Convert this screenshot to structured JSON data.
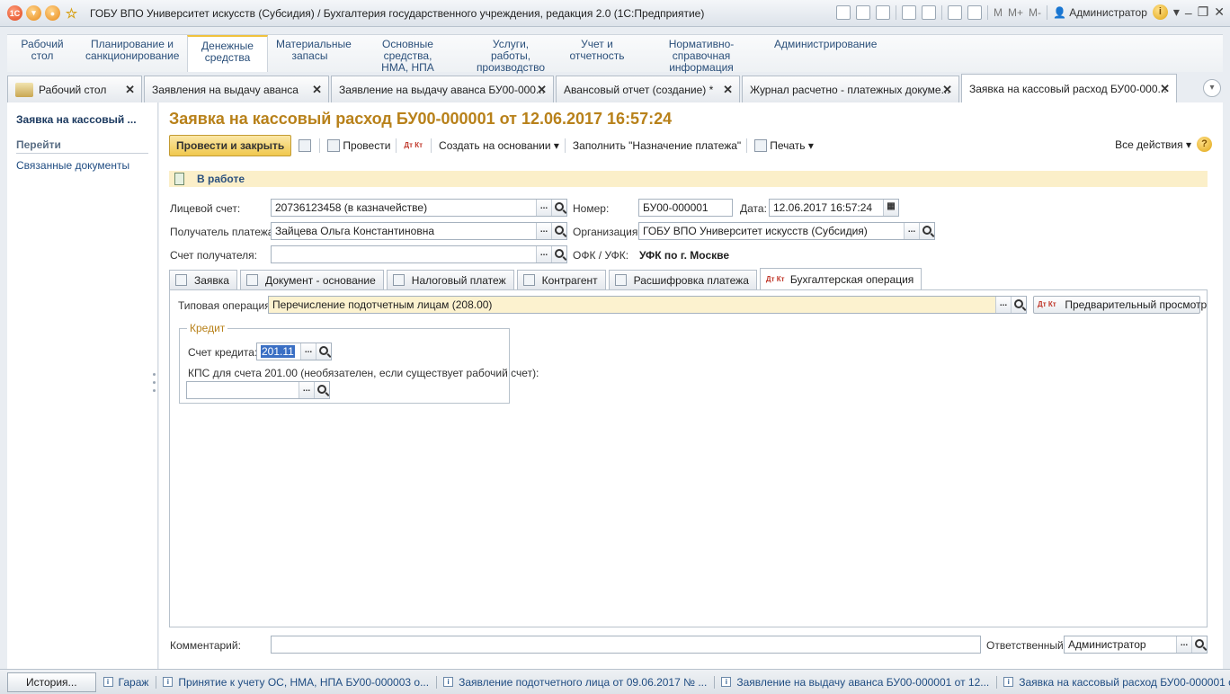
{
  "window": {
    "title": "ГОБУ ВПО Университет искусств (Субсидия) / Бухгалтерия государственного учреждения, редакция 2.0  (1С:Предприятие)",
    "user": "Администратор",
    "memory_buttons": [
      "M",
      "M+",
      "M-"
    ]
  },
  "sections": [
    {
      "label": "Рабочий\nстол"
    },
    {
      "label": "Планирование и\nсанкционирование"
    },
    {
      "label": "Денежные\nсредства"
    },
    {
      "label": "Материальные\nзапасы"
    },
    {
      "label": "Основные средства,\nНМА, НПА"
    },
    {
      "label": "Услуги, работы,\nпроизводство"
    },
    {
      "label": "Учет и\nотчетность"
    },
    {
      "label": "Нормативно-справочная\nинформация"
    },
    {
      "label": "Администрирование"
    }
  ],
  "open_tabs": [
    {
      "label": "Рабочий стол"
    },
    {
      "label": "Заявления на выдачу аванса"
    },
    {
      "label": "Заявление на выдачу аванса БУ00-000..."
    },
    {
      "label": "Авансовый отчет (создание) *"
    },
    {
      "label": "Журнал расчетно - платежных докуме..."
    },
    {
      "label": "Заявка на кассовый расход БУ00-000..."
    }
  ],
  "left_panel": {
    "title": "Заявка на кассовый ...",
    "go_label": "Перейти",
    "link": "Связанные документы"
  },
  "form": {
    "title": "Заявка на кассовый расход БУ00-000001 от 12.06.2017 16:57:24",
    "commands": {
      "post_close": "Провести и закрыть",
      "post": "Провести",
      "create_based": "Создать на основании",
      "fill_purpose": "Заполнить \"Назначение платежа\"",
      "print": "Печать",
      "all_actions": "Все действия",
      "dt_kt": "Дт Кт"
    },
    "status": "В работе",
    "fields": {
      "account_label": "Лицевой счет:",
      "account_value": "20736123458 (в казначействе)",
      "number_label": "Номер:",
      "number_value": "БУ00-000001",
      "date_label": "Дата:",
      "date_value": "12.06.2017 16:57:24",
      "recipient_label": "Получатель платежа:",
      "recipient_value": "Зайцева Ольга Константиновна",
      "org_label": "Организация:",
      "org_value": "ГОБУ ВПО Университет искусств (Субсидия)",
      "recipient_account_label": "Счет получателя:",
      "recipient_account_value": "",
      "ofk_label": "ОФК / УФК:",
      "ofk_value": "УФК по г. Москве"
    },
    "tabs": [
      {
        "label": "Заявка"
      },
      {
        "label": "Документ - основание"
      },
      {
        "label": "Налоговый платеж"
      },
      {
        "label": "Контрагент"
      },
      {
        "label": "Расшифровка платежа"
      },
      {
        "label": "Бухгалтерская операция"
      }
    ],
    "operation": {
      "label": "Типовая операция:",
      "value": "Перечисление подотчетным лицам (208.00)",
      "preview_button": "Предварительный просмотр"
    },
    "credit": {
      "group_title": "Кредит",
      "account_label": "Счет кредита:",
      "account_value": "201.11",
      "kps_label": "КПС для счета 201.00 (необязателен, если существует рабочий счет):",
      "kps_value": ""
    },
    "comment_label": "Комментарий:",
    "comment_value": "",
    "responsible_label": "Ответственный:",
    "responsible_value": "Администратор"
  },
  "history": {
    "button": "История...",
    "items": [
      "Гараж",
      "Принятие к учету ОС, НМА, НПА БУ00-000003 о...",
      "Заявление подотчетного лица от 09.06.2017 № ...",
      "Заявление на выдачу аванса БУ00-000001 от 12...",
      "Заявка на кассовый расход БУ00-000001 от 12..."
    ]
  }
}
